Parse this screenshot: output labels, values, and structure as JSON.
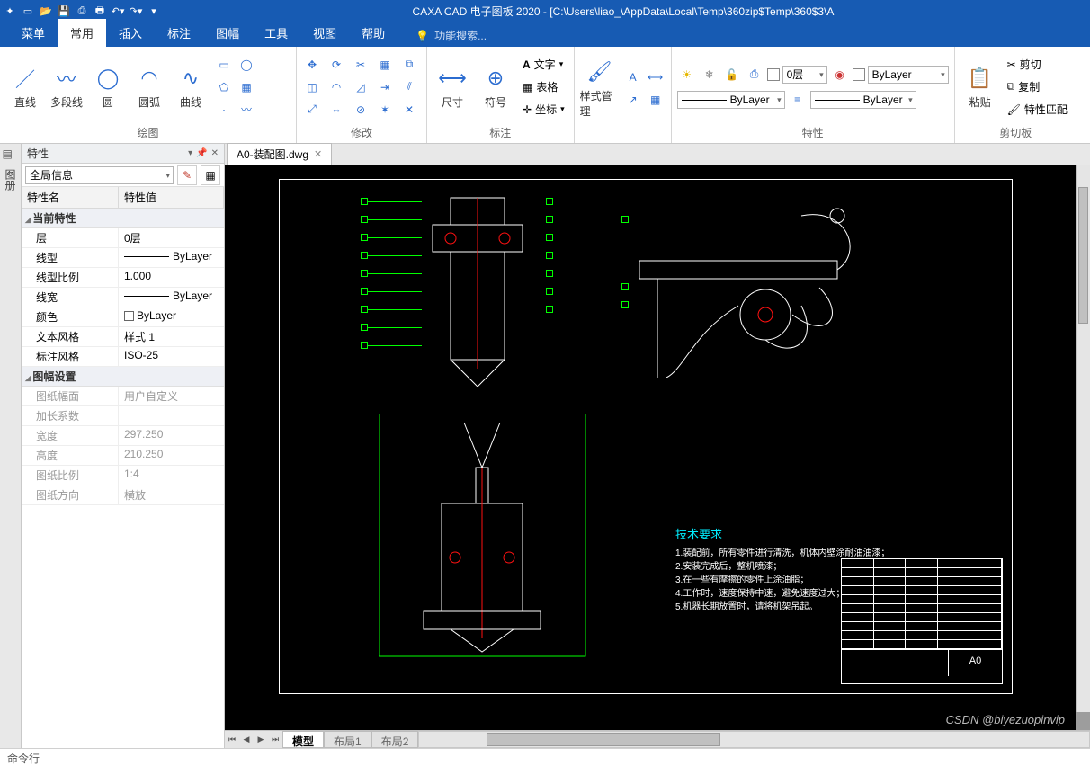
{
  "title": "CAXA CAD 电子图板 2020 - [C:\\Users\\liao_\\AppData\\Local\\Temp\\360zip$Temp\\360$3\\A",
  "menu": [
    "菜单",
    "常用",
    "插入",
    "标注",
    "图幅",
    "工具",
    "视图",
    "帮助"
  ],
  "menu_active_index": 1,
  "search_hint": "功能搜索...",
  "ribbon": {
    "draw": {
      "label": "绘图",
      "btns": [
        "直线",
        "多段线",
        "圆",
        "圆弧",
        "曲线"
      ]
    },
    "modify": {
      "label": "修改"
    },
    "annot": {
      "label": "标注",
      "btns": [
        "尺寸",
        "符号"
      ],
      "text": "文字",
      "table": "表格",
      "coord": "坐标"
    },
    "style": {
      "label": "",
      "btn": "样式管理"
    },
    "props": {
      "label": "特性",
      "layer": "0层",
      "bylayer1": "ByLayer",
      "bylayer2": "ByLayer",
      "bylayer3": "ByLayer"
    },
    "clip": {
      "label": "剪切板",
      "btn": "粘贴",
      "cut": "剪切",
      "copy": "复制",
      "match": "特性匹配"
    }
  },
  "side_label": "图册",
  "props_panel": {
    "title": "特性",
    "selector": "全局信息",
    "head_name": "特性名",
    "head_val": "特性值",
    "sec_current": "当前特性",
    "rows_current": [
      {
        "n": "层",
        "v": "0层"
      },
      {
        "n": "线型",
        "v": "ByLayer",
        "line": true
      },
      {
        "n": "线型比例",
        "v": "1.000"
      },
      {
        "n": "线宽",
        "v": "ByLayer",
        "line": true
      },
      {
        "n": "颜色",
        "v": "ByLayer",
        "sw": true
      },
      {
        "n": "文本风格",
        "v": "样式 1"
      },
      {
        "n": "标注风格",
        "v": "ISO-25"
      }
    ],
    "sec_sheet": "图幅设置",
    "rows_sheet": [
      {
        "n": "图纸幅面",
        "v": "用户自定义"
      },
      {
        "n": "加长系数",
        "v": ""
      },
      {
        "n": "宽度",
        "v": "297.250"
      },
      {
        "n": "高度",
        "v": "210.250"
      },
      {
        "n": "图纸比例",
        "v": "1:4"
      },
      {
        "n": "图纸方向",
        "v": "横放"
      }
    ]
  },
  "doc_tab": "A0-装配图.dwg",
  "model_tabs": [
    "模型",
    "布局1",
    "布局2"
  ],
  "techreq": {
    "title": "技术要求",
    "lines": [
      "1.装配前，所有零件进行清洗，机体内壁涂耐油油漆；",
      "2.安装完成后，整机喷漆；",
      "3.在一些有摩擦的零件上涂油脂；",
      "4.工作时，速度保持中速，避免速度过大；",
      "5.机器长期放置时，请将机架吊起。"
    ]
  },
  "titleblock_size": "A0",
  "watermark": "CSDN @biyezuopinvip",
  "status": "命令行"
}
